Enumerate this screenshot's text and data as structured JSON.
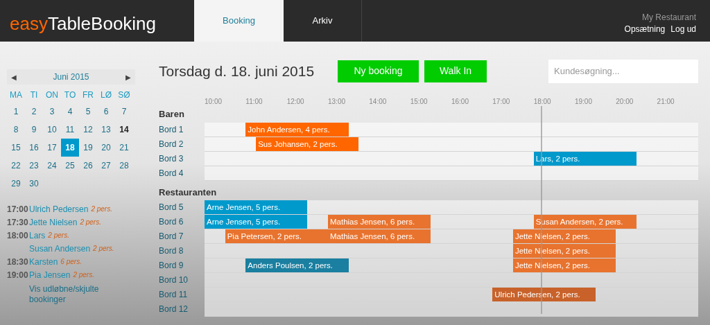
{
  "logo": {
    "part_1": "easy",
    "part_2": "TableBooking"
  },
  "tabs": [
    {
      "label": "Booking",
      "selected": true
    },
    {
      "label": "Arkiv",
      "selected": false
    }
  ],
  "account": {
    "restaurant": "My Restaurant",
    "links": [
      "Opsætning",
      "Log ud"
    ]
  },
  "calendar": {
    "prev": "◀",
    "month": "Juni 2015",
    "next": "▶",
    "weekdays": [
      "MA",
      "TI",
      "ON",
      "TO",
      "FR",
      "LØ",
      "SØ"
    ],
    "days": [
      {
        "label": "1",
        "selected": false,
        "today": false
      },
      {
        "label": "2",
        "selected": false,
        "today": false
      },
      {
        "label": "3",
        "selected": false,
        "today": false
      },
      {
        "label": "4",
        "selected": false,
        "today": false
      },
      {
        "label": "5",
        "selected": false,
        "today": false
      },
      {
        "label": "6",
        "selected": false,
        "today": false
      },
      {
        "label": "7",
        "selected": false,
        "today": false
      },
      {
        "label": "8",
        "selected": false,
        "today": false
      },
      {
        "label": "9",
        "selected": false,
        "today": false
      },
      {
        "label": "10",
        "selected": false,
        "today": false
      },
      {
        "label": "11",
        "selected": false,
        "today": false
      },
      {
        "label": "12",
        "selected": false,
        "today": false
      },
      {
        "label": "13",
        "selected": false,
        "today": false
      },
      {
        "label": "14",
        "selected": false,
        "today": true
      },
      {
        "label": "15",
        "selected": false,
        "today": false
      },
      {
        "label": "16",
        "selected": false,
        "today": false
      },
      {
        "label": "17",
        "selected": false,
        "today": false
      },
      {
        "label": "18",
        "selected": true,
        "today": false
      },
      {
        "label": "19",
        "selected": false,
        "today": false
      },
      {
        "label": "20",
        "selected": false,
        "today": false
      },
      {
        "label": "21",
        "selected": false,
        "today": false
      },
      {
        "label": "22",
        "selected": false,
        "today": false
      },
      {
        "label": "23",
        "selected": false,
        "today": false
      },
      {
        "label": "24",
        "selected": false,
        "today": false
      },
      {
        "label": "25",
        "selected": false,
        "today": false
      },
      {
        "label": "26",
        "selected": false,
        "today": false
      },
      {
        "label": "27",
        "selected": false,
        "today": false
      },
      {
        "label": "28",
        "selected": false,
        "today": false
      },
      {
        "label": "29",
        "selected": false,
        "today": false
      },
      {
        "label": "30",
        "selected": false,
        "today": false
      }
    ]
  },
  "upcoming": [
    {
      "time": "17:00",
      "name": "Ulrich Pedersen",
      "guests": "2 pers."
    },
    {
      "time": "17:30",
      "name": "Jette Nielsen",
      "guests": "2 pers."
    },
    {
      "time": "18:00",
      "name": "Lars",
      "guests": "2 pers."
    },
    {
      "name": "Susan Andersen",
      "guests": "2 pers."
    },
    {
      "time": "18:30",
      "name": "Karsten",
      "guests": "6 pers."
    },
    {
      "time": "19:00",
      "name": "Pia Jensen",
      "guests": "2 pers."
    }
  ],
  "show_hidden_link": "Vis udløbne/skjulte bookinger",
  "date_title": "Torsdag d. 18. juni 2015",
  "buttons": [
    "Ny booking",
    "Walk In"
  ],
  "search": {
    "placeholder": "Kundesøgning..."
  },
  "hours": [
    "10:00",
    "11:00",
    "12:00",
    "13:00",
    "14:00",
    "15:00",
    "16:00",
    "17:00",
    "18:00",
    "19:00",
    "20:00",
    "21:00"
  ],
  "sections": [
    {
      "name": "Baren",
      "tables": [
        {
          "name": "Bord 1",
          "bookings": [
            {
              "label": "John Andersen, 4 pers.",
              "color": "#ff6600"
            }
          ]
        },
        {
          "name": "Bord 2",
          "bookings": [
            {
              "label": "Sus Johansen, 2 pers.",
              "color": "#ff6600"
            }
          ]
        },
        {
          "name": "Bord 3",
          "bookings": [
            {
              "label": "Lars, 2 pers.",
              "color": "#0099cc"
            }
          ]
        },
        {
          "name": "Bord 4"
        }
      ]
    },
    {
      "name": "Restauranten",
      "tables": [
        {
          "name": "Bord 5",
          "bookings": [
            {
              "label": "Arne Jensen, 5 pers.",
              "color": "#0099cc"
            }
          ]
        },
        {
          "name": "Bord 6",
          "bookings": [
            {
              "label": "Arne Jensen, 5 pers.",
              "color": "#0099cc"
            },
            {
              "label": "Mathias Jensen, 6 pers.",
              "color": "#e8732e"
            },
            {
              "label": "Susan Andersen, 2 pers.",
              "color": "#e8732e"
            }
          ]
        },
        {
          "name": "Bord 7",
          "bookings": [
            {
              "label": "Pia Petersen, 2 pers.",
              "color": "#e8732e"
            },
            {
              "label": "Mathias Jensen, 6 pers.",
              "color": "#e8732e"
            },
            {
              "label": "Jette Nielsen, 2 pers.",
              "color": "#e8732e"
            }
          ]
        },
        {
          "name": "Bord 8",
          "bookings": [
            {
              "label": "Jette Nielsen, 2 pers.",
              "color": "#e8732e"
            }
          ]
        },
        {
          "name": "Bord 9",
          "bookings": [
            {
              "label": "Anders Poulsen, 2 pers.",
              "color": "#1a7fa0"
            },
            {
              "label": "Jette Nielsen, 2 pers.",
              "color": "#e8732e"
            }
          ]
        },
        {
          "name": "Bord 10"
        },
        {
          "name": "Bord 11",
          "bookings": [
            {
              "label": "Ulrich Pedersen, 2 pers.",
              "color": "#c8622a"
            }
          ]
        },
        {
          "name": "Bord 12"
        }
      ]
    }
  ]
}
